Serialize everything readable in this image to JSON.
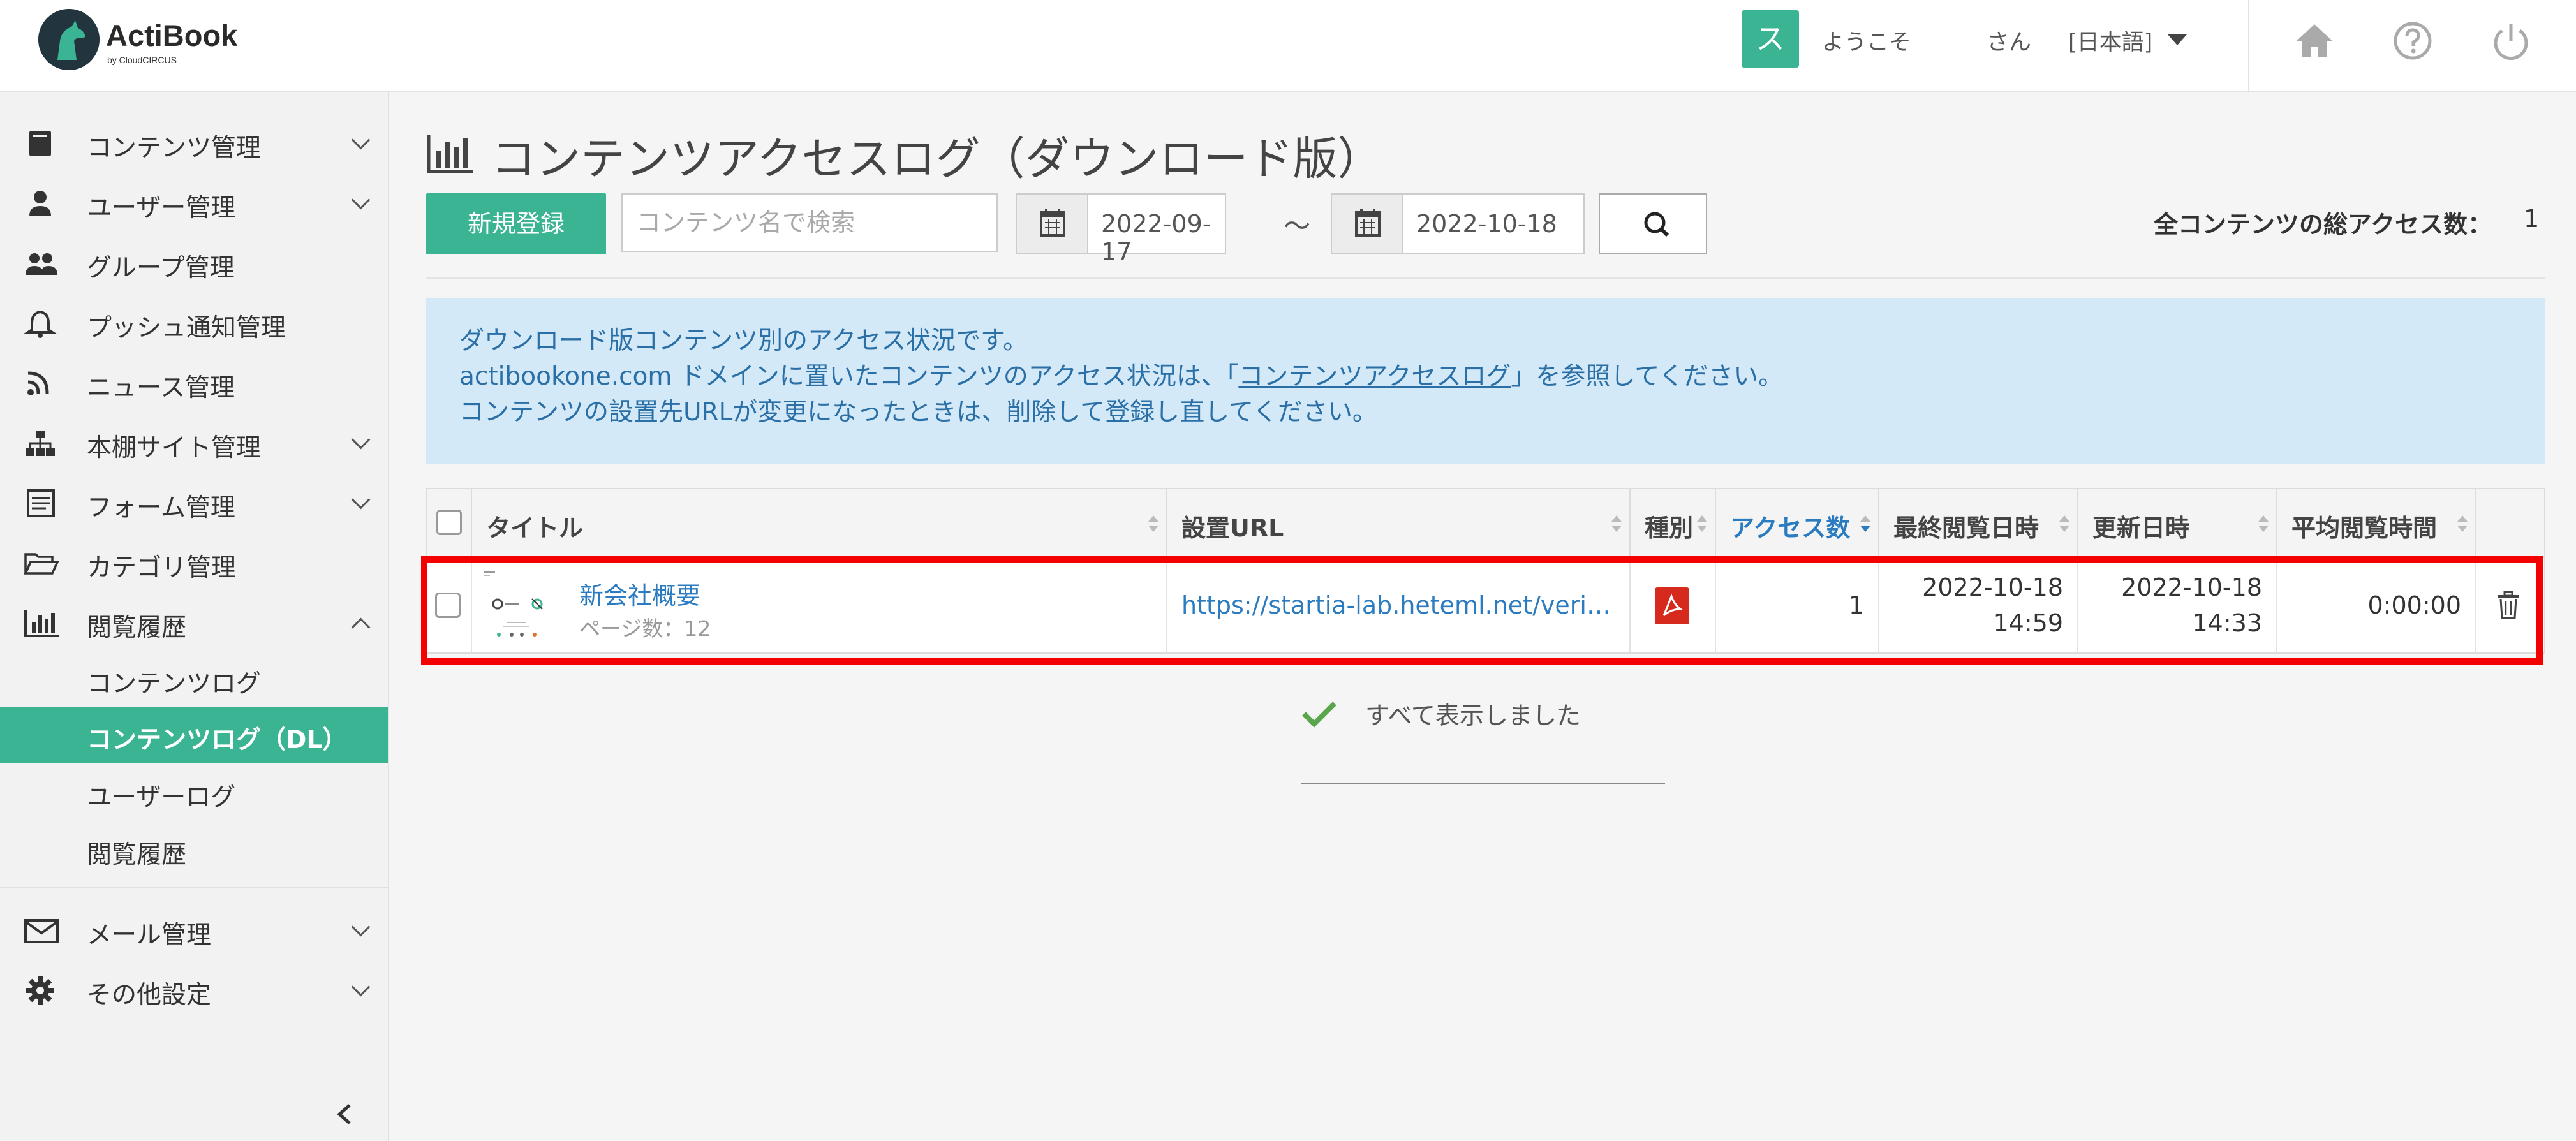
{
  "app": {
    "logo_title": "ActiBook",
    "logo_sub": "by CloudCIRCUS",
    "brand_color": "#3bb494"
  },
  "header": {
    "user_initial": "ス",
    "welcome": "ようこそ",
    "san": "さん",
    "language": "[日本語]",
    "icons": [
      "home-icon",
      "help-icon",
      "power-icon"
    ]
  },
  "sidebar": {
    "items": [
      {
        "label": "コンテンツ管理",
        "icon": "book-icon",
        "expandable": true
      },
      {
        "label": "ユーザー管理",
        "icon": "user-icon",
        "expandable": true
      },
      {
        "label": "グループ管理",
        "icon": "group-icon",
        "expandable": false
      },
      {
        "label": "プッシュ通知管理",
        "icon": "bell-icon",
        "expandable": false
      },
      {
        "label": "ニュース管理",
        "icon": "rss-icon",
        "expandable": false
      },
      {
        "label": "本棚サイト管理",
        "icon": "sitemap-icon",
        "expandable": true
      },
      {
        "label": "フォーム管理",
        "icon": "form-icon",
        "expandable": true
      },
      {
        "label": "カテゴリ管理",
        "icon": "folder-icon",
        "expandable": false
      },
      {
        "label": "閲覧履歴",
        "icon": "bar-chart-icon",
        "expandable": true,
        "expanded": true
      }
    ],
    "sub_items": [
      {
        "label": "コンテンツログ",
        "active": false
      },
      {
        "label": "コンテンツログ（DL）",
        "active": true
      },
      {
        "label": "ユーザーログ",
        "active": false
      },
      {
        "label": "閲覧履歴",
        "active": false
      }
    ],
    "bottom_items": [
      {
        "label": "メール管理",
        "icon": "mail-icon",
        "expandable": true
      },
      {
        "label": "その他設定",
        "icon": "gear-icon",
        "expandable": true
      }
    ]
  },
  "main": {
    "title": "コンテンツアクセスログ（ダウンロード版）",
    "new_button": "新規登録",
    "search_placeholder": "コンテンツ名で検索",
    "date_from": "2022-09-17",
    "date_to": "2022-10-18",
    "date_separator": "～",
    "total_label": "全コンテンツの総アクセス数：",
    "total_value": "1",
    "info": {
      "line1": "ダウンロード版コンテンツ別のアクセス状況です。",
      "line2_pre": "actibookone.com ドメインに置いたコンテンツのアクセス状況は、「",
      "line2_link": "コンテンツアクセスログ",
      "line2_post": "」を参照してください。",
      "line3": "コンテンツの設置先URLが変更になったときは、削除して登録し直してください。"
    },
    "table": {
      "columns": [
        "タイトル",
        "設置URL",
        "種別",
        "アクセス数",
        "最終閲覧日時",
        "更新日時",
        "平均閲覧時間"
      ],
      "sorted_column": "アクセス数",
      "rows": [
        {
          "title": "新会社概要",
          "pages": "ページ数：12",
          "url": "https://startia-lab.heteml.net/verifi…",
          "type": "pdf",
          "access_count": "1",
          "last_viewed_date": "2022-10-18",
          "last_viewed_time": "14:59",
          "updated_date": "2022-10-18",
          "updated_time": "14:33",
          "avg_time": "0:00:00"
        }
      ]
    },
    "all_shown": "すべて表示しました",
    "highlight_color": "#f40000"
  }
}
